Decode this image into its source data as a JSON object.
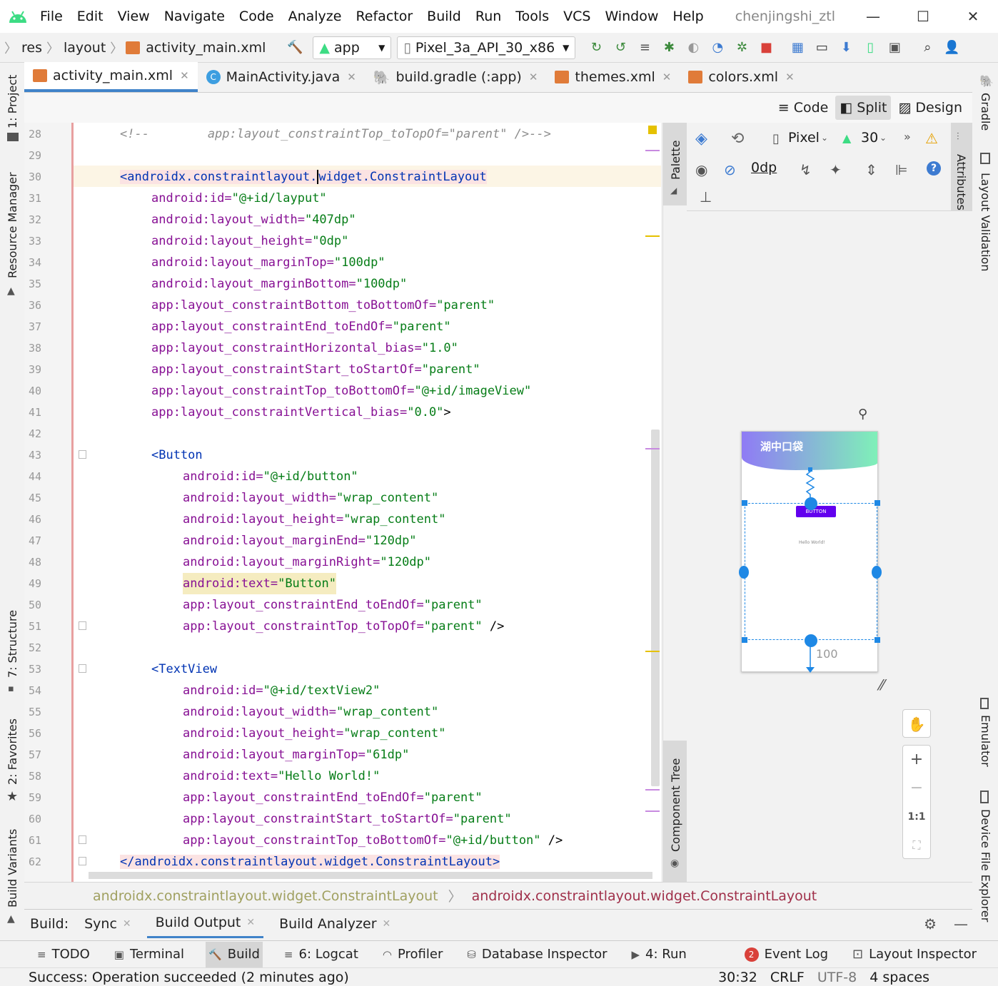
{
  "menu": [
    "File",
    "Edit",
    "View",
    "Navigate",
    "Code",
    "Analyze",
    "Refactor",
    "Build",
    "Run",
    "Tools",
    "VCS",
    "Window",
    "Help"
  ],
  "project_name": "chenjingshi_ztl",
  "breadcrumbs": [
    "res",
    "layout",
    "activity_main.xml"
  ],
  "run_config": "app",
  "device": "Pixel_3a_API_30_x86",
  "tabs": [
    {
      "label": "activity_main.xml",
      "icon": "xml-icon",
      "active": true
    },
    {
      "label": "MainActivity.java",
      "icon": "java-class-icon"
    },
    {
      "label": "build.gradle (:app)",
      "icon": "gradle-icon"
    },
    {
      "label": "themes.xml",
      "icon": "xml-icon"
    },
    {
      "label": "colors.xml",
      "icon": "xml-icon"
    }
  ],
  "view_modes": {
    "code": "Code",
    "split": "Split",
    "design": "Design"
  },
  "left_tools": {
    "project": "1: Project",
    "resource_manager": "Resource Manager",
    "structure": "7: Structure",
    "favorites": "2: Favorites",
    "build_variants": "Build Variants"
  },
  "right_tools": {
    "gradle": "Gradle",
    "layout_validation": "Layout Validation",
    "emulator": "Emulator",
    "device_file_explorer": "Device File Explorer"
  },
  "palette_label": "Palette",
  "component_tree_label": "Component Tree",
  "attributes_label": "Attributes",
  "design_toolbar": {
    "device": "Pixel",
    "api": "30",
    "margin": "0dp"
  },
  "preview": {
    "app_title": "湖中口袋",
    "button_text": "BUTTON",
    "textview_text": "Hello World!",
    "margin_label": "100",
    "colors": {
      "header_start": "#8f7bf5",
      "header_end": "#7ff0b8",
      "button": "#6200ee",
      "selection": "#1e88e5"
    }
  },
  "zoom_controls": {
    "one_to_one": "1:1"
  },
  "code_lines": [
    {
      "n": "28"
    },
    {
      "n": "29"
    },
    {
      "n": "30"
    },
    {
      "n": "31"
    },
    {
      "n": "32"
    },
    {
      "n": "33"
    },
    {
      "n": "34"
    },
    {
      "n": "35"
    },
    {
      "n": "36"
    },
    {
      "n": "37"
    },
    {
      "n": "38"
    },
    {
      "n": "39"
    },
    {
      "n": "40"
    },
    {
      "n": "41"
    },
    {
      "n": "42"
    },
    {
      "n": "43"
    },
    {
      "n": "44"
    },
    {
      "n": "45"
    },
    {
      "n": "46"
    },
    {
      "n": "47"
    },
    {
      "n": "48"
    },
    {
      "n": "49"
    },
    {
      "n": "50"
    },
    {
      "n": "51"
    },
    {
      "n": "52"
    },
    {
      "n": "53"
    },
    {
      "n": "54"
    },
    {
      "n": "55"
    },
    {
      "n": "56"
    },
    {
      "n": "57"
    },
    {
      "n": "58"
    },
    {
      "n": "59"
    },
    {
      "n": "60"
    },
    {
      "n": "61"
    },
    {
      "n": "62"
    }
  ],
  "code": {
    "l28": "<!--        app:layout_constraintTop_toTopOf=\"parent\" />-->",
    "l30a": "<androidx.constraintlayout.",
    "l30b": "widget",
    "l30c": ".ConstraintLayout",
    "l31": [
      "android:",
      "id=",
      "\"@+id/layput\""
    ],
    "l32": [
      "android:",
      "layout_width=",
      "\"407dp\""
    ],
    "l33": [
      "android:",
      "layout_height=",
      "\"0dp\""
    ],
    "l34": [
      "android:",
      "layout_marginTop=",
      "\"100dp\""
    ],
    "l35": [
      "android:",
      "layout_marginBottom=",
      "\"100dp\""
    ],
    "l36": [
      "app:",
      "layout_constraintBottom_toBottomOf=",
      "\"parent\""
    ],
    "l37": [
      "app:",
      "layout_constraintEnd_toEndOf=",
      "\"parent\""
    ],
    "l38": [
      "app:",
      "layout_constraintHorizontal_bias=",
      "\"1.0\""
    ],
    "l39": [
      "app:",
      "layout_constraintStart_toStartOf=",
      "\"parent\""
    ],
    "l40": [
      "app:",
      "layout_constraintTop_toBottomOf=",
      "\"@+id/imageView\""
    ],
    "l41": [
      "app:",
      "layout_constraintVertical_bias=",
      "\"0.0\"",
      ">"
    ],
    "l43": "<Button",
    "l44": [
      "android:",
      "id=",
      "\"@+id/button\""
    ],
    "l45": [
      "android:",
      "layout_width=",
      "\"wrap_content\""
    ],
    "l46": [
      "android:",
      "layout_height=",
      "\"wrap_content\""
    ],
    "l47": [
      "android:",
      "layout_marginEnd=",
      "\"120dp\""
    ],
    "l48": [
      "android:",
      "layout_marginRight=",
      "\"120dp\""
    ],
    "l49": [
      "android:",
      "text=",
      "\"Button\""
    ],
    "l50": [
      "app:",
      "layout_constraintEnd_toEndOf=",
      "\"parent\""
    ],
    "l51": [
      "app:",
      "layout_constraintTop_toTopOf=",
      "\"parent\"",
      " />"
    ],
    "l53": "<TextView",
    "l54": [
      "android:",
      "id=",
      "\"@+id/textView2\""
    ],
    "l55": [
      "android:",
      "layout_width=",
      "\"wrap_content\""
    ],
    "l56": [
      "android:",
      "layout_height=",
      "\"wrap_content\""
    ],
    "l57": [
      "android:",
      "layout_marginTop=",
      "\"61dp\""
    ],
    "l58": [
      "android:",
      "text=",
      "\"Hello World!\""
    ],
    "l59": [
      "app:",
      "layout_constraintEnd_toEndOf=",
      "\"parent\""
    ],
    "l60": [
      "app:",
      "layout_constraintStart_toStartOf=",
      "\"parent\""
    ],
    "l61": [
      "app:",
      "layout_constraintTop_toBottomOf=",
      "\"@+id/button\"",
      " />"
    ],
    "l62": "</androidx.constraintlayout.widget.ConstraintLayout>"
  },
  "path_bar": [
    "androidx.constraintlayout.widget.ConstraintLayout",
    "androidx.constraintlayout.widget.ConstraintLayout"
  ],
  "build_bar": {
    "label": "Build:",
    "tabs": [
      "Sync",
      "Build Output",
      "Build Analyzer"
    ]
  },
  "tool_windows": [
    {
      "label": "TODO",
      "icon": "list-icon"
    },
    {
      "label": "Terminal",
      "icon": "terminal-icon"
    },
    {
      "label": "Build",
      "icon": "hammer-icon",
      "active": true
    },
    {
      "label": "6: Logcat",
      "icon": "logcat-icon"
    },
    {
      "label": "Profiler",
      "icon": "profiler-icon"
    },
    {
      "label": "Database Inspector",
      "icon": "database-icon"
    },
    {
      "label": "4: Run",
      "icon": "run-icon"
    }
  ],
  "right_tool_windows": [
    {
      "label": "Event Log",
      "badge": "2"
    },
    {
      "label": "Layout Inspector"
    }
  ],
  "status": {
    "message": "Success: Operation succeeded (2 minutes ago)",
    "position": "30:32",
    "line_sep": "CRLF",
    "encoding": "UTF-8",
    "indent": "4 spaces"
  }
}
